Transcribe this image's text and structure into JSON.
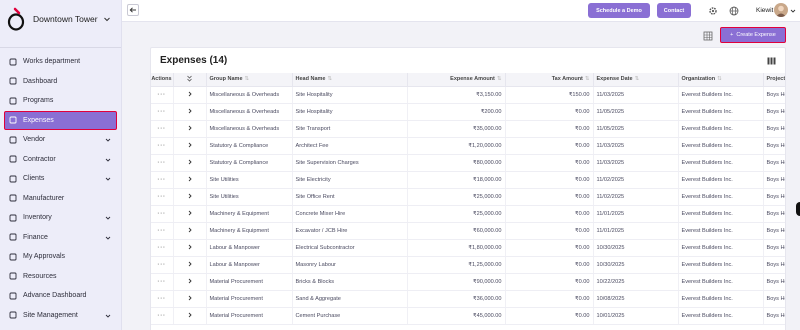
{
  "brand": {
    "name": "Downtown Tower"
  },
  "sidebar": {
    "items": [
      {
        "label": "Works department",
        "icon": "home-icon",
        "chevron": false,
        "active": false
      },
      {
        "label": "Dashboard",
        "icon": "dashboard-icon",
        "chevron": false,
        "active": false
      },
      {
        "label": "Programs",
        "icon": "programs-icon",
        "chevron": false,
        "active": false
      },
      {
        "label": "Expenses",
        "icon": "expenses-icon",
        "chevron": false,
        "active": true
      },
      {
        "label": "Vendor",
        "icon": "vendor-icon",
        "chevron": true,
        "active": false
      },
      {
        "label": "Contractor",
        "icon": "contractor-icon",
        "chevron": true,
        "active": false
      },
      {
        "label": "Clients",
        "icon": "clients-icon",
        "chevron": true,
        "active": false
      },
      {
        "label": "Manufacturer",
        "icon": "manufacturer-icon",
        "chevron": false,
        "active": false
      },
      {
        "label": "Inventory",
        "icon": "inventory-icon",
        "chevron": true,
        "active": false
      },
      {
        "label": "Finance",
        "icon": "finance-icon",
        "chevron": true,
        "active": false
      },
      {
        "label": "My Approvals",
        "icon": "approvals-icon",
        "chevron": false,
        "active": false
      },
      {
        "label": "Resources",
        "icon": "resources-icon",
        "chevron": false,
        "active": false
      },
      {
        "label": "Advance Dashboard",
        "icon": "chart-icon",
        "chevron": false,
        "active": false
      },
      {
        "label": "Site Management",
        "icon": "site-icon",
        "chevron": true,
        "active": false
      }
    ]
  },
  "topbar": {
    "demo_label": "Schedule a Demo",
    "contact_label": "Contact",
    "user_name": "Kiewit"
  },
  "toolbar": {
    "create_label": "Create Expense"
  },
  "expenses": {
    "title": "Expenses (14)",
    "columns": [
      "Actions",
      "",
      "Group Name",
      "Head Name",
      "Expense Amount",
      "Tax Amount",
      "Expense Date",
      "Organization",
      "Project"
    ],
    "rows": [
      [
        "Miscellaneous & Overheads",
        "Site Hospitality",
        "₹3,150.00",
        "₹150.00",
        "11/03/2025",
        "Everest Builders Inc.",
        "Boys Hostel Building (G+"
      ],
      [
        "Miscellaneous & Overheads",
        "Site Hospitality",
        "₹200.00",
        "₹0.00",
        "11/05/2025",
        "Everest Builders Inc.",
        "Boys Hostel Building (G+"
      ],
      [
        "Miscellaneous & Overheads",
        "Site Transport",
        "₹35,000.00",
        "₹0.00",
        "11/05/2025",
        "Everest Builders Inc.",
        "Boys Hostel Building (G+"
      ],
      [
        "Statutory & Compliance",
        "Architect Fee",
        "₹1,20,000.00",
        "₹0.00",
        "11/03/2025",
        "Everest Builders Inc.",
        "Boys Hostel Building (G+"
      ],
      [
        "Statutory & Compliance",
        "Site Supervision Charges",
        "₹80,000.00",
        "₹0.00",
        "11/03/2025",
        "Everest Builders Inc.",
        "Boys Hostel Building (G+"
      ],
      [
        "Site Utilities",
        "Site Electricity",
        "₹18,000.00",
        "₹0.00",
        "11/02/2025",
        "Everest Builders Inc.",
        "Boys Hostel Building (G+"
      ],
      [
        "Site Utilities",
        "Site Office Rent",
        "₹25,000.00",
        "₹0.00",
        "11/02/2025",
        "Everest Builders Inc.",
        "Boys Hostel Building (G+"
      ],
      [
        "Machinery & Equipment",
        "Concrete Mixer Hire",
        "₹25,000.00",
        "₹0.00",
        "11/01/2025",
        "Everest Builders Inc.",
        "Boys Hostel Building (G+"
      ],
      [
        "Machinery & Equipment",
        "Excavator / JCB Hire",
        "₹60,000.00",
        "₹0.00",
        "11/01/2025",
        "Everest Builders Inc.",
        "Boys Hostel Building (G+"
      ],
      [
        "Labour & Manpower",
        "Electrical Subcontractor",
        "₹1,80,000.00",
        "₹0.00",
        "10/30/2025",
        "Everest Builders Inc.",
        "Boys Hostel Building (G+"
      ],
      [
        "Labour & Manpower",
        "Masonry Labour",
        "₹1,25,000.00",
        "₹0.00",
        "10/30/2025",
        "Everest Builders Inc.",
        "Boys Hostel Building (G+"
      ],
      [
        "Material Procurement",
        "Bricks & Blocks",
        "₹90,000.00",
        "₹0.00",
        "10/22/2025",
        "Everest Builders Inc.",
        "Boys Hostel Building (G+"
      ],
      [
        "Material Procurement",
        "Sand & Aggregate",
        "₹36,000.00",
        "₹0.00",
        "10/08/2025",
        "Everest Builders Inc.",
        "Boys Hostel Building (G+"
      ],
      [
        "Material Procurement",
        "Cement Purchase",
        "₹45,000.00",
        "₹0.00",
        "10/01/2025",
        "Everest Builders Inc.",
        "Boys Hostel Building (G+"
      ]
    ]
  }
}
